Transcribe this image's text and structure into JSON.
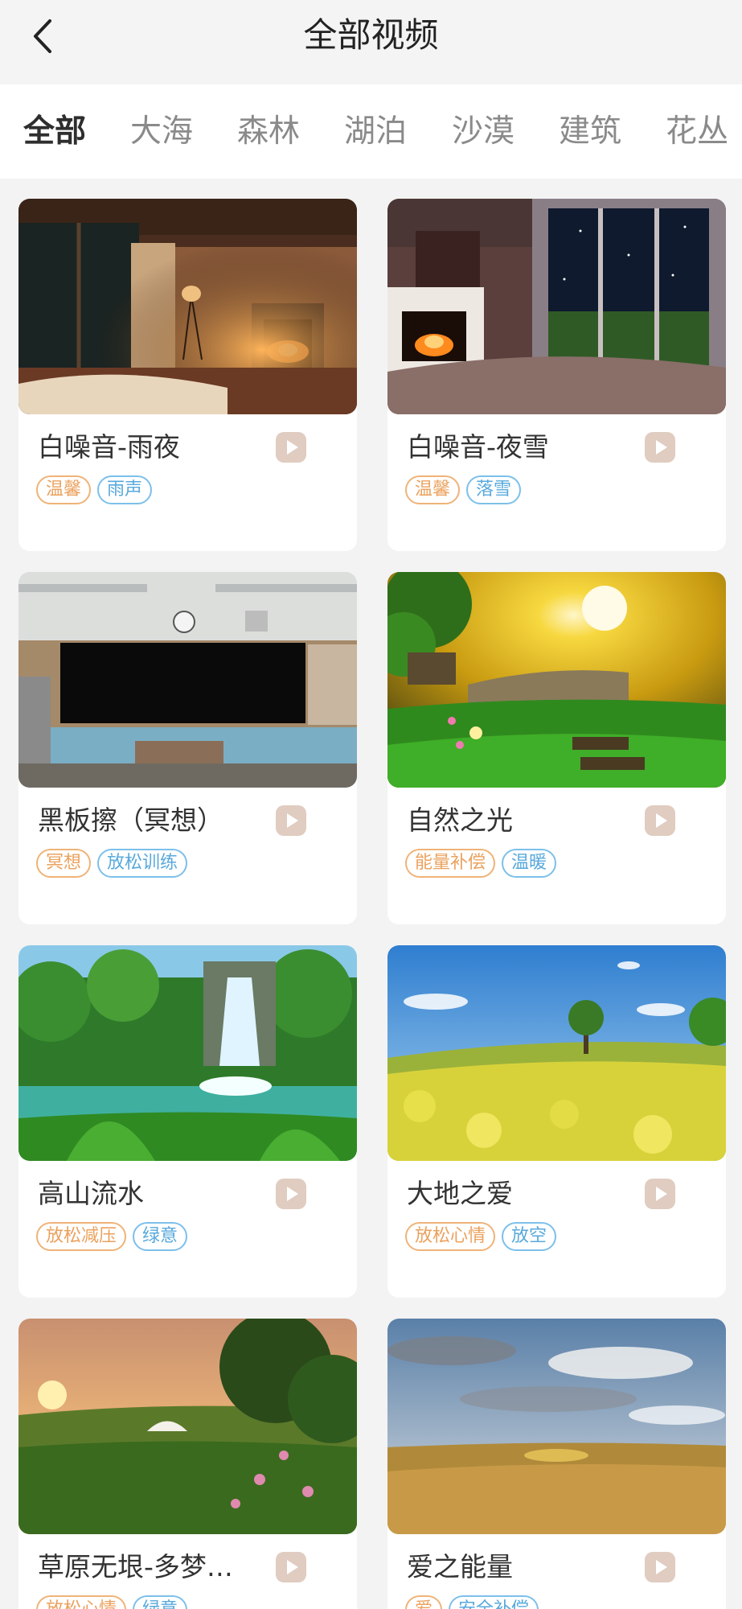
{
  "header": {
    "title": "全部视频",
    "back_icon": "chevron-left-icon"
  },
  "tabs": [
    {
      "label": "全部",
      "active": true
    },
    {
      "label": "大海",
      "active": false
    },
    {
      "label": "森林",
      "active": false
    },
    {
      "label": "湖泊",
      "active": false
    },
    {
      "label": "沙漠",
      "active": false
    },
    {
      "label": "建筑",
      "active": false
    },
    {
      "label": "花丛",
      "active": false
    }
  ],
  "colors": {
    "tag_orange": "#eba25e",
    "tag_blue": "#58a9dc",
    "play_button": "#e0ccc0",
    "background": "#f3f3f3"
  },
  "videos": [
    {
      "title": "白噪音-雨夜",
      "scene": "cozy-room-fireplace-rain-window",
      "tags": [
        {
          "text": "温馨",
          "color": "orange"
        },
        {
          "text": "雨声",
          "color": "blue"
        }
      ]
    },
    {
      "title": "白噪音-夜雪",
      "scene": "bedroom-fireplace-night-window",
      "tags": [
        {
          "text": "温馨",
          "color": "orange"
        },
        {
          "text": "落雪",
          "color": "blue"
        }
      ]
    },
    {
      "title": "黑板擦（冥想）",
      "scene": "classroom-blackboard",
      "tags": [
        {
          "text": "冥想",
          "color": "orange"
        },
        {
          "text": "放松训练",
          "color": "blue"
        }
      ]
    },
    {
      "title": "自然之光",
      "scene": "sunlit-garden",
      "tags": [
        {
          "text": "能量补偿",
          "color": "orange"
        },
        {
          "text": "温暖",
          "color": "blue"
        }
      ]
    },
    {
      "title": "高山流水",
      "scene": "jungle-waterfall",
      "tags": [
        {
          "text": "放松减压",
          "color": "orange"
        },
        {
          "text": "绿意",
          "color": "blue"
        }
      ]
    },
    {
      "title": "大地之爱",
      "scene": "yellow-flower-field-tree",
      "tags": [
        {
          "text": "放松心情",
          "color": "orange"
        },
        {
          "text": "放空",
          "color": "blue"
        }
      ]
    },
    {
      "title": "草原无垠-多梦…",
      "scene": "grassland-sunset-yurt",
      "tags": [
        {
          "text": "放松心情",
          "color": "orange"
        },
        {
          "text": "绿意",
          "color": "blue"
        }
      ]
    },
    {
      "title": "爱之能量",
      "scene": "golden-wheat-field-sky",
      "tags": [
        {
          "text": "爱",
          "color": "orange"
        },
        {
          "text": "安全补偿",
          "color": "blue"
        }
      ]
    }
  ]
}
